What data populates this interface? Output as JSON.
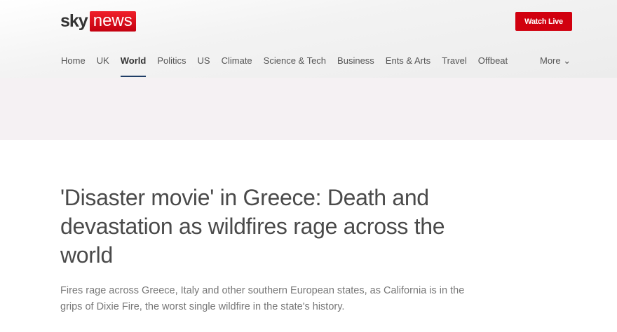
{
  "header": {
    "logo_sky": "sky",
    "logo_news": "news",
    "watch_live": "Watch Live"
  },
  "nav": {
    "items": [
      "Home",
      "UK",
      "World",
      "Politics",
      "US",
      "Climate",
      "Science & Tech",
      "Business",
      "Ents & Arts",
      "Travel",
      "Offbeat"
    ],
    "active": "World",
    "more": "More"
  },
  "article": {
    "headline": "'Disaster movie' in Greece: Death and devastation as wildfires rage across the world",
    "standfirst": "Fires rage across Greece, Italy and other southern European states, as California is in the grips of Dixie Fire, the worst single wildfire in the state's history."
  }
}
